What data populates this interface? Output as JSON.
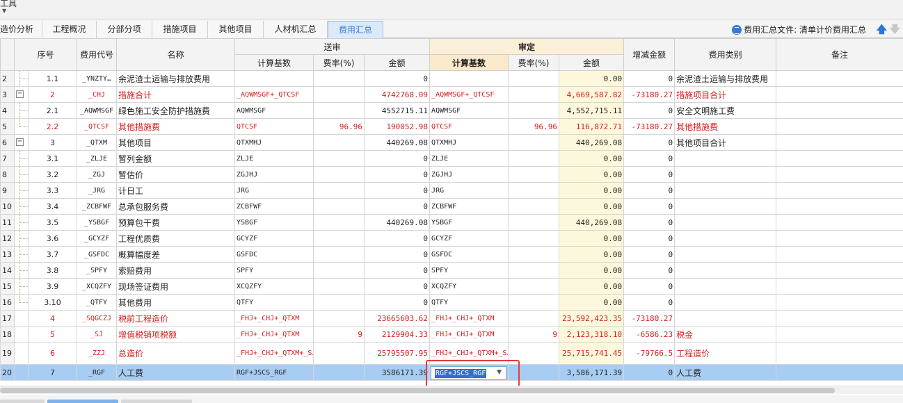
{
  "window": {
    "title_fragment": "工具"
  },
  "tabs": [
    {
      "label": "造价分析",
      "active": false
    },
    {
      "label": "工程概况",
      "active": false
    },
    {
      "label": "分部分项",
      "active": false
    },
    {
      "label": "措施项目",
      "active": false
    },
    {
      "label": "其他项目",
      "active": false
    },
    {
      "label": "人材机汇总",
      "active": false
    },
    {
      "label": "费用汇总",
      "active": true
    }
  ],
  "file_info": {
    "label": "费用汇总文件: 清单计价费用汇总"
  },
  "colors": {
    "accent": "#3a7ad0",
    "red_text": "#d61c1c",
    "selected_row": "#a8cdf3",
    "highlight_box": "#e53b3b",
    "sd_header": "#fcefd8"
  },
  "columns": {
    "seq": "序号",
    "code": "费用代号",
    "name": "名称",
    "group_songshen": "送审",
    "group_shending": "审定",
    "base": "计算基数",
    "rate": "费率(%)",
    "amount": "金额",
    "diff": "增减金额",
    "category": "费用类别",
    "note": "备注"
  },
  "rows": [
    {
      "rn": "2",
      "tree": "child",
      "seq": "1.1",
      "code": "_YNZTY…",
      "name": "余泥渣土运输与排放费用",
      "ss_base": "",
      "ss_rate": "",
      "ss_amt": "0",
      "sd_base": "",
      "sd_rate": "",
      "sd_amt": "0.00",
      "diff": "0",
      "cat": "余泥渣土运输与排放费用",
      "red": false
    },
    {
      "rn": "3",
      "tree": "parent",
      "seq": "2",
      "code": "_CHJ",
      "name": "措施合计",
      "ss_base": "_AQWMSGF+_QTCSF",
      "ss_rate": "",
      "ss_amt": "4742768.09",
      "sd_base": "_AQWMSGF+_QTCSF",
      "sd_rate": "",
      "sd_amt": "4,669,587.82",
      "diff": "-73180.27",
      "cat": "措施项目合计",
      "red": true
    },
    {
      "rn": "4",
      "tree": "child",
      "seq": "2.1",
      "code": "_AQWMSGF",
      "name": "绿色施工安全防护措施费",
      "ss_base": "AQWMSGF",
      "ss_rate": "",
      "ss_amt": "4552715.11",
      "sd_base": "AQWMSGF",
      "sd_rate": "",
      "sd_amt": "4,552,715.11",
      "diff": "0",
      "cat": "安全文明施工费",
      "red": false
    },
    {
      "rn": "5",
      "tree": "last",
      "seq": "2.2",
      "code": "_QTCSF",
      "name": "其他措施费",
      "ss_base": "QTCSF",
      "ss_rate": "96.96",
      "ss_amt": "190052.98",
      "sd_base": "QTCSF",
      "sd_rate": "96.96",
      "sd_amt": "116,872.71",
      "diff": "-73180.27",
      "cat": "其他措施费",
      "red": true
    },
    {
      "rn": "6",
      "tree": "parent",
      "seq": "3",
      "code": "_QTXM",
      "name": "其他项目",
      "ss_base": "QTXMHJ",
      "ss_rate": "",
      "ss_amt": "440269.08",
      "sd_base": "QTXMHJ",
      "sd_rate": "",
      "sd_amt": "440,269.08",
      "diff": "0",
      "cat": "其他项目合计",
      "red": false
    },
    {
      "rn": "7",
      "tree": "child",
      "seq": "3.1",
      "code": "_ZLJE",
      "name": "暂列金额",
      "ss_base": "ZLJE",
      "ss_rate": "",
      "ss_amt": "0",
      "sd_base": "ZLJE",
      "sd_rate": "",
      "sd_amt": "0.00",
      "diff": "0",
      "cat": "",
      "red": false
    },
    {
      "rn": "8",
      "tree": "child",
      "seq": "3.2",
      "code": "_ZGJ",
      "name": "暂估价",
      "ss_base": "ZGJHJ",
      "ss_rate": "",
      "ss_amt": "0",
      "sd_base": "ZGJHJ",
      "sd_rate": "",
      "sd_amt": "0.00",
      "diff": "0",
      "cat": "",
      "red": false
    },
    {
      "rn": "9",
      "tree": "child",
      "seq": "3.3",
      "code": "_JRG",
      "name": "计日工",
      "ss_base": "JRG",
      "ss_rate": "",
      "ss_amt": "0",
      "sd_base": "JRG",
      "sd_rate": "",
      "sd_amt": "0.00",
      "diff": "0",
      "cat": "",
      "red": false
    },
    {
      "rn": "10",
      "tree": "child",
      "seq": "3.4",
      "code": "_ZCBFWF",
      "name": "总承包服务费",
      "ss_base": "ZCBFWF",
      "ss_rate": "",
      "ss_amt": "0",
      "sd_base": "ZCBFWF",
      "sd_rate": "",
      "sd_amt": "0.00",
      "diff": "0",
      "cat": "",
      "red": false
    },
    {
      "rn": "11",
      "tree": "child",
      "seq": "3.5",
      "code": "_YSBGF",
      "name": "预算包干费",
      "ss_base": "YSBGF",
      "ss_rate": "",
      "ss_amt": "440269.08",
      "sd_base": "YSBGF",
      "sd_rate": "",
      "sd_amt": "440,269.08",
      "diff": "0",
      "cat": "",
      "red": false
    },
    {
      "rn": "12",
      "tree": "child",
      "seq": "3.6",
      "code": "_GCYZF",
      "name": "工程优质费",
      "ss_base": "GCYZF",
      "ss_rate": "",
      "ss_amt": "0",
      "sd_base": "GCYZF",
      "sd_rate": "",
      "sd_amt": "0.00",
      "diff": "0",
      "cat": "",
      "red": false
    },
    {
      "rn": "13",
      "tree": "child",
      "seq": "3.7",
      "code": "_GSFDC",
      "name": "概算幅度差",
      "ss_base": "GSFDC",
      "ss_rate": "",
      "ss_amt": "0",
      "sd_base": "GSFDC",
      "sd_rate": "",
      "sd_amt": "0.00",
      "diff": "0",
      "cat": "",
      "red": false
    },
    {
      "rn": "14",
      "tree": "child",
      "seq": "3.8",
      "code": "_SPFY",
      "name": "索赔费用",
      "ss_base": "SPFY",
      "ss_rate": "",
      "ss_amt": "0",
      "sd_base": "SPFY",
      "sd_rate": "",
      "sd_amt": "0.00",
      "diff": "0",
      "cat": "",
      "red": false
    },
    {
      "rn": "15",
      "tree": "child",
      "seq": "3.9",
      "code": "_XCQZFY",
      "name": "现场签证费用",
      "ss_base": "XCQZFY",
      "ss_rate": "",
      "ss_amt": "0",
      "sd_base": "XCQZFY",
      "sd_rate": "",
      "sd_amt": "0.00",
      "diff": "0",
      "cat": "",
      "red": false
    },
    {
      "rn": "16",
      "tree": "last",
      "seq": "3.10",
      "code": "_QTFY",
      "name": "其他费用",
      "ss_base": "QTFY",
      "ss_rate": "",
      "ss_amt": "0",
      "sd_base": "QTFY",
      "sd_rate": "",
      "sd_amt": "0.00",
      "diff": "0",
      "cat": "",
      "red": false
    },
    {
      "rn": "17",
      "tree": "none",
      "seq": "4",
      "code": "_SQGCZJ",
      "name": "税前工程造价",
      "ss_base": "_FHJ+_CHJ+_QTXM",
      "ss_rate": "",
      "ss_amt": "23665603.62",
      "sd_base": "_FHJ+_CHJ+_QTXM",
      "sd_rate": "",
      "sd_amt": "23,592,423.35",
      "diff": "-73180.27",
      "cat": "",
      "red": true
    },
    {
      "rn": "18",
      "tree": "none",
      "seq": "5",
      "code": "_SJ",
      "name": "增值税销项税额",
      "ss_base": "_FHJ+_CHJ+_QTXM",
      "ss_rate": "9",
      "ss_amt": "2129904.33",
      "sd_base": "_FHJ+_CHJ+_QTXM",
      "sd_rate": "9",
      "sd_amt": "2,123,318.10",
      "diff": "-6586.23",
      "cat": "税金",
      "red": true
    },
    {
      "rn": "19",
      "tree": "none",
      "seq": "6",
      "code": "_ZZJ",
      "name": "总造价",
      "ss_base": "_FHJ+_CHJ+_QTXM+_SJ",
      "ss_rate": "",
      "ss_amt": "25795507.95",
      "sd_base": "_FHJ+_CHJ+_QTXM+_SJ",
      "sd_rate": "",
      "sd_amt": "25,715,741.45",
      "diff": "-79766.5",
      "cat": "工程造价",
      "red": true
    },
    {
      "rn": "20",
      "tree": "none",
      "seq": "7",
      "code": "_RGF",
      "name": "人工费",
      "ss_base": "RGF+JSCS_RGF",
      "ss_rate": "",
      "ss_amt": "3586171.39",
      "sd_base": "",
      "sd_rate": "",
      "sd_amt": "3,586,171.39",
      "diff": "0",
      "cat": "人工费",
      "red": false,
      "selected": true
    }
  ],
  "editor": {
    "value": "RGF+JSCS_RGF"
  }
}
